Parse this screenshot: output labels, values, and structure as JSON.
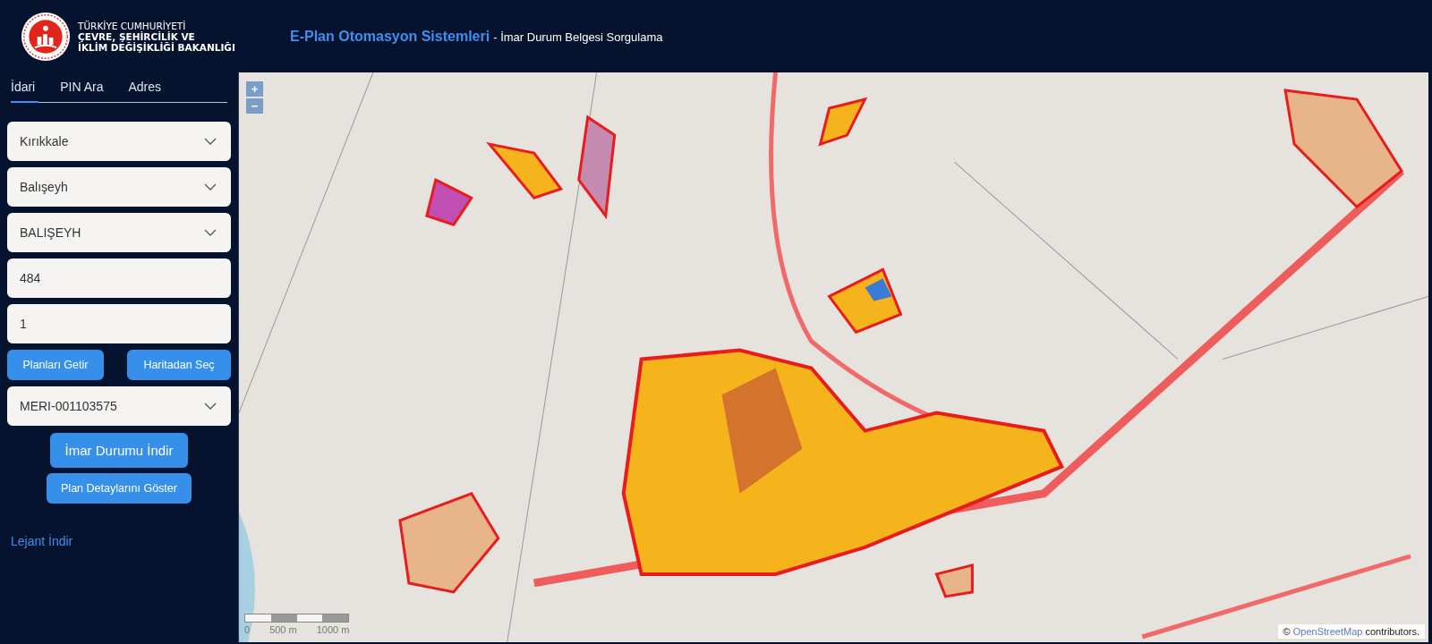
{
  "header": {
    "ministry_lines": [
      "TÜRKİYE CUMHURİYETİ",
      "ÇEVRE, ŞEHİRCİLİK VE",
      "İKLİM DEĞİŞİKLİĞİ BAKANLIĞI"
    ],
    "title": "E-Plan Otomasyon Sistemleri",
    "subtitle": "- İmar Durum Belgesi Sorgulama"
  },
  "sidebar": {
    "tabs": [
      {
        "label": "İdari",
        "selected": true
      },
      {
        "label": "PIN Ara",
        "selected": false
      },
      {
        "label": "Adres",
        "selected": false
      }
    ],
    "fields": [
      {
        "kind": "select",
        "value": "Kırıkkale"
      },
      {
        "kind": "select",
        "value": "Balışeyh"
      },
      {
        "kind": "select",
        "value": "BALIŞEYH"
      },
      {
        "kind": "input",
        "value": "484"
      },
      {
        "kind": "input",
        "value": "1"
      },
      {
        "kind": "buttons",
        "buttons": [
          "Planları Getir",
          "Haritadan Seç"
        ]
      },
      {
        "kind": "select",
        "value": "MERI-001103575"
      }
    ],
    "actions": [
      "İmar Durumu İndir",
      "Plan Detaylarını Göster"
    ],
    "legend_link": "Lejant İndir"
  },
  "map": {
    "zoom_in": "+",
    "zoom_out": "−",
    "scale_labels": [
      "0",
      "500 m",
      "1000 m"
    ],
    "attribution": {
      "prefix": "©",
      "link": "OpenStreetMap",
      "suffix": "contributors."
    }
  }
}
